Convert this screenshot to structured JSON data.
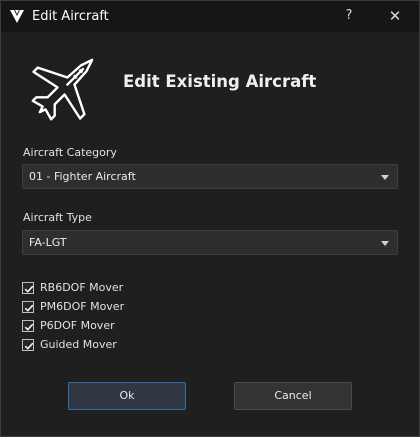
{
  "window": {
    "title": "Edit Aircraft",
    "help_label": "?",
    "close_label": "✕"
  },
  "header": {
    "title": "Edit Existing Aircraft",
    "icon": "fighter-jet-icon"
  },
  "category": {
    "label": "Aircraft Category",
    "selected": "01 - Fighter Aircraft"
  },
  "type": {
    "label": "Aircraft Type",
    "selected": "FA-LGT"
  },
  "movers": [
    {
      "label": "RB6DOF Mover",
      "checked": true
    },
    {
      "label": "PM6DOF Mover",
      "checked": true
    },
    {
      "label": "P6DOF Mover",
      "checked": true
    },
    {
      "label": "Guided Mover",
      "checked": true
    }
  ],
  "buttons": {
    "ok": "Ok",
    "cancel": "Cancel"
  },
  "colors": {
    "background": "#1f1f1f",
    "titlebar": "#161616",
    "default_button_border": "#2f6ea8"
  }
}
